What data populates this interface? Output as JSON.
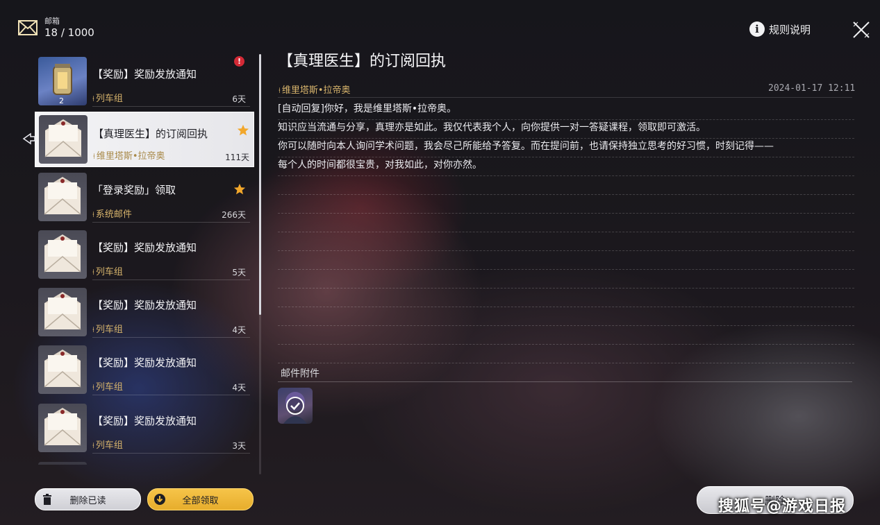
{
  "header": {
    "mailbox_label": "邮箱",
    "mail_count": "18 / 1000",
    "rules_label": "规则说明"
  },
  "mail_list": [
    {
      "title": "【奖励】奖励发放通知",
      "sender": "列车组",
      "days": "6天",
      "thumb": "reward-lantern-icon",
      "reward_count": "2",
      "badge": "alert"
    },
    {
      "title": "【真理医生】的订阅回执",
      "sender": "维里塔斯•拉帝奥",
      "days": "111天",
      "thumb": "envelope-icon",
      "badge": "star",
      "selected": true
    },
    {
      "title": "「登录奖励」领取",
      "sender": "系统邮件",
      "days": "266天",
      "thumb": "envelope-icon",
      "badge": "star"
    },
    {
      "title": "【奖励】奖励发放通知",
      "sender": "列车组",
      "days": "5天",
      "thumb": "envelope-icon"
    },
    {
      "title": "【奖励】奖励发放通知",
      "sender": "列车组",
      "days": "4天",
      "thumb": "envelope-icon"
    },
    {
      "title": "【奖励】奖励发放通知",
      "sender": "列车组",
      "days": "4天",
      "thumb": "envelope-icon"
    },
    {
      "title": "【奖励】奖励发放通知",
      "sender": "列车组",
      "days": "3天",
      "thumb": "envelope-icon"
    }
  ],
  "list_buttons": {
    "delete_read": "删除已读",
    "claim_all": "全部领取"
  },
  "detail": {
    "title": "【真理医生】的订阅回执",
    "sender": "维里塔斯•拉帝奥",
    "date": "2024-01-17 12:11",
    "body_lines": [
      "[自动回复]你好，我是维里塔斯•拉帝奥。",
      "知识应当流通与分享，真理亦是如此。我仅代表我个人，向你提供一对一答疑课程，领取即可激活。",
      "你可以随时向本人询问学术问题，我会尽己所能给予答复。而在提问前，也请保持独立思考的好习惯，时刻记得——",
      "每个人的时间都很宝贵，对我如此，对你亦然。"
    ],
    "attachments_label": "邮件附件",
    "attachment_claimed": true,
    "delete_button": "删除"
  },
  "watermark": "搜狐号@游戏日报",
  "colors": {
    "accent_gold": "#d7b46c",
    "claim_yellow": "#f1b935",
    "alert_red": "#d42a36",
    "star_orange": "#f2a72b"
  }
}
